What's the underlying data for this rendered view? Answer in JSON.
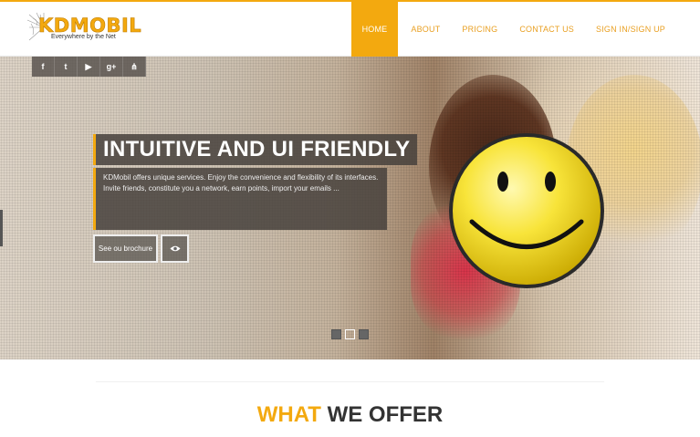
{
  "logo": {
    "brand": "KDMOBIL",
    "tagline": "Everywhere by the Net"
  },
  "nav": {
    "items": [
      {
        "label": "HOME",
        "active": true
      },
      {
        "label": "ABOUT",
        "active": false
      },
      {
        "label": "PRICING",
        "active": false
      },
      {
        "label": "CONTACT US",
        "active": false
      },
      {
        "label": "SIGN IN/SIGN UP",
        "active": false
      }
    ]
  },
  "social": {
    "icons": [
      "facebook-icon",
      "twitter-icon",
      "youtube-icon",
      "googleplus-icon",
      "sitemap-icon"
    ],
    "glyphs": [
      "f",
      "t",
      "▶",
      "g+",
      "⋔"
    ]
  },
  "slide": {
    "title": "INTUITIVE AND UI FRIENDLY",
    "description": "KDMobil offers unique services. Enjoy the convenience and flexibility of its interfaces. Invite friends, constitute you a network, earn points, import your emails ...",
    "brochure_label": "See ou brochure",
    "eye_icon": "eye-icon"
  },
  "slider": {
    "slides": 3,
    "active_index": 1
  },
  "section": {
    "title_highlight": "WHAT",
    "title_rest": " WE OFFER"
  },
  "colors": {
    "accent": "#f3a90f",
    "text_dark": "#333333"
  }
}
